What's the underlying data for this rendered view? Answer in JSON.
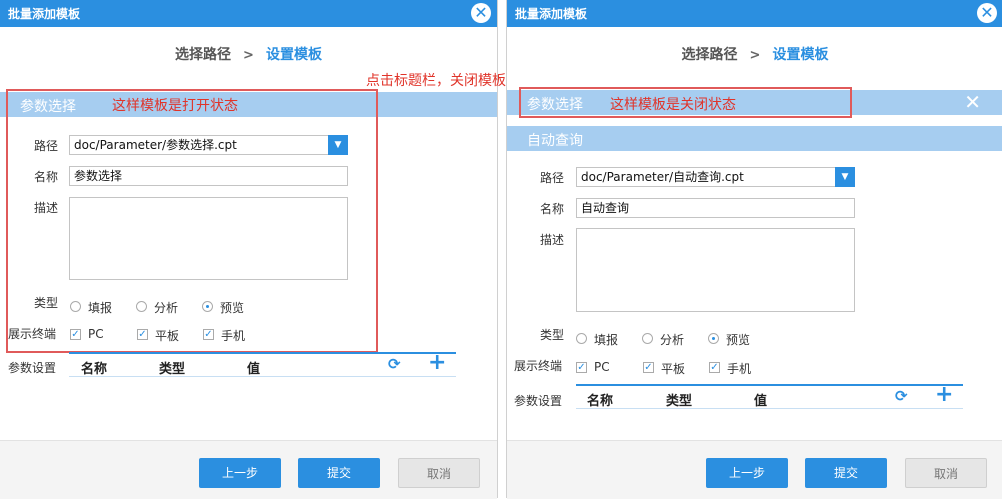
{
  "left": {
    "title": "批量添加模板",
    "steps": {
      "step1": "选择路径",
      "arrow": ">",
      "step2": "设置模板"
    },
    "panel_title": "参数选择",
    "annotation": "这样模板是打开状态",
    "path_label": "路径",
    "path_value": "doc/Parameter/参数选择.cpt",
    "name_label": "名称",
    "name_value": "参数选择",
    "desc_label": "描述",
    "type_label": "类型",
    "types": [
      "填报",
      "分析",
      "预览"
    ],
    "type_selected": "预览",
    "terminal_label": "展示终端",
    "terminals": [
      "PC",
      "平板",
      "手机"
    ],
    "params_label": "参数设置",
    "columns": [
      "名称",
      "类型",
      "值"
    ],
    "buttons": {
      "prev": "上一步",
      "submit": "提交",
      "cancel": "取消"
    }
  },
  "center_annotation": "点击标题栏，关闭模板",
  "right": {
    "title": "批量添加模板",
    "steps": {
      "step1": "选择路径",
      "arrow": ">",
      "step2": "设置模板"
    },
    "panel_title": "参数选择",
    "annotation": "这样模板是关闭状态",
    "panel2_title": "自动查询",
    "path_label": "路径",
    "path_value": "doc/Parameter/自动查询.cpt",
    "name_label": "名称",
    "name_value": "自动查询",
    "desc_label": "描述",
    "type_label": "类型",
    "types": [
      "填报",
      "分析",
      "预览"
    ],
    "type_selected": "预览",
    "terminal_label": "展示终端",
    "terminals": [
      "PC",
      "平板",
      "手机"
    ],
    "params_label": "参数设置",
    "columns": [
      "名称",
      "类型",
      "值"
    ],
    "buttons": {
      "prev": "上一步",
      "submit": "提交",
      "cancel": "取消"
    }
  },
  "colors": {
    "accent": "#2b8fe0",
    "panel": "#a6cdf0",
    "annotation_red": "#e0342a"
  },
  "icons": {
    "close": "close-circle-icon",
    "dropdown": "caret-down-icon",
    "refresh": "refresh-icon",
    "add": "plus-icon",
    "panel_close": "x-icon"
  }
}
